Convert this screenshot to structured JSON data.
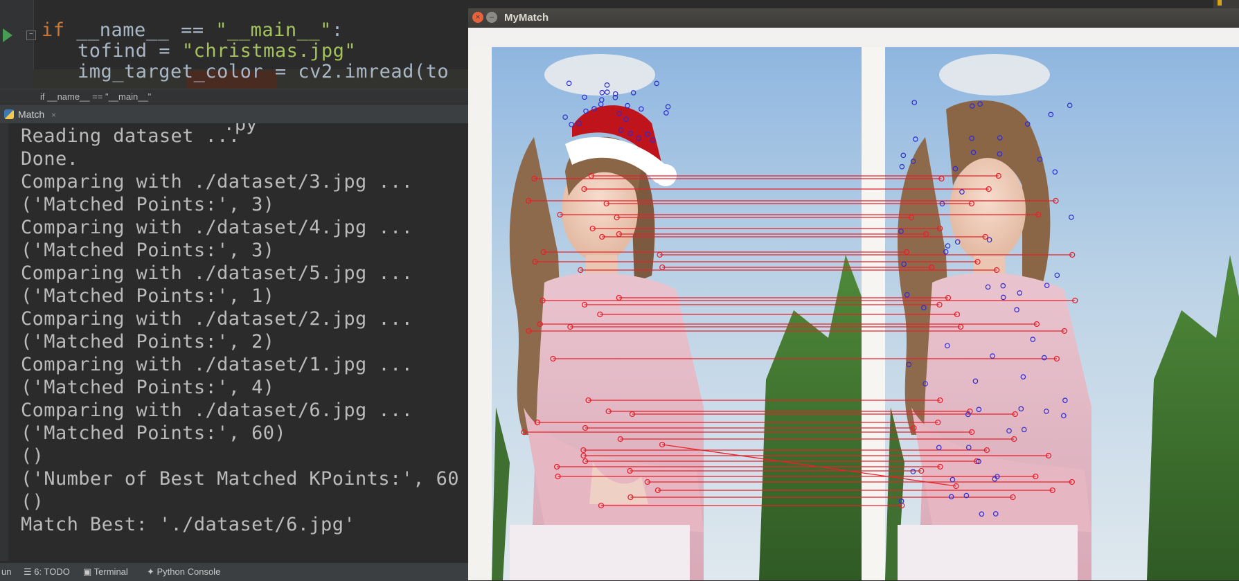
{
  "editor": {
    "line1": {
      "keyword": "if",
      "name": "__name__",
      "op": " == ",
      "str": "\"__main__\"",
      "colon": ":"
    },
    "line2": {
      "var": "tofind",
      "eq": " = ",
      "str": "\"christmas.jpg\""
    },
    "line3": {
      "text": "img_target_color = cv2.imread(to"
    },
    "fold_glyph": "−",
    "run_icon": "run-arrow-icon"
  },
  "breadcrumb": "if __name__ == \"__main__\"",
  "run_tab": {
    "label": "Match",
    "close": "×"
  },
  "console": {
    "partial_top": "                  .py",
    "lines": [
      "Reading dataset ...",
      "Done.",
      "Comparing with ./dataset/3.jpg ...",
      "('Matched Points:', 3)",
      "Comparing with ./dataset/4.jpg ...",
      "('Matched Points:', 3)",
      "Comparing with ./dataset/5.jpg ...",
      "('Matched Points:', 1)",
      "Comparing with ./dataset/2.jpg ...",
      "('Matched Points:', 2)",
      "Comparing with ./dataset/1.jpg ...",
      "('Matched Points:', 4)",
      "Comparing with ./dataset/6.jpg ...",
      "('Matched Points:', 60)",
      "()",
      "('Number of Best Matched KPoints:', 60",
      "()",
      "Match Best: './dataset/6.jpg'"
    ]
  },
  "statusbar": {
    "run": "un",
    "todo": "6: TODO",
    "terminal": "Terminal",
    "python_console": "Python Console"
  },
  "window": {
    "title": "MyMatch",
    "close": "×",
    "minimize": "–"
  },
  "colors": {
    "match_line": "#e8202a",
    "keypoint": "#2b2bd6",
    "hat": "#c0141c"
  }
}
